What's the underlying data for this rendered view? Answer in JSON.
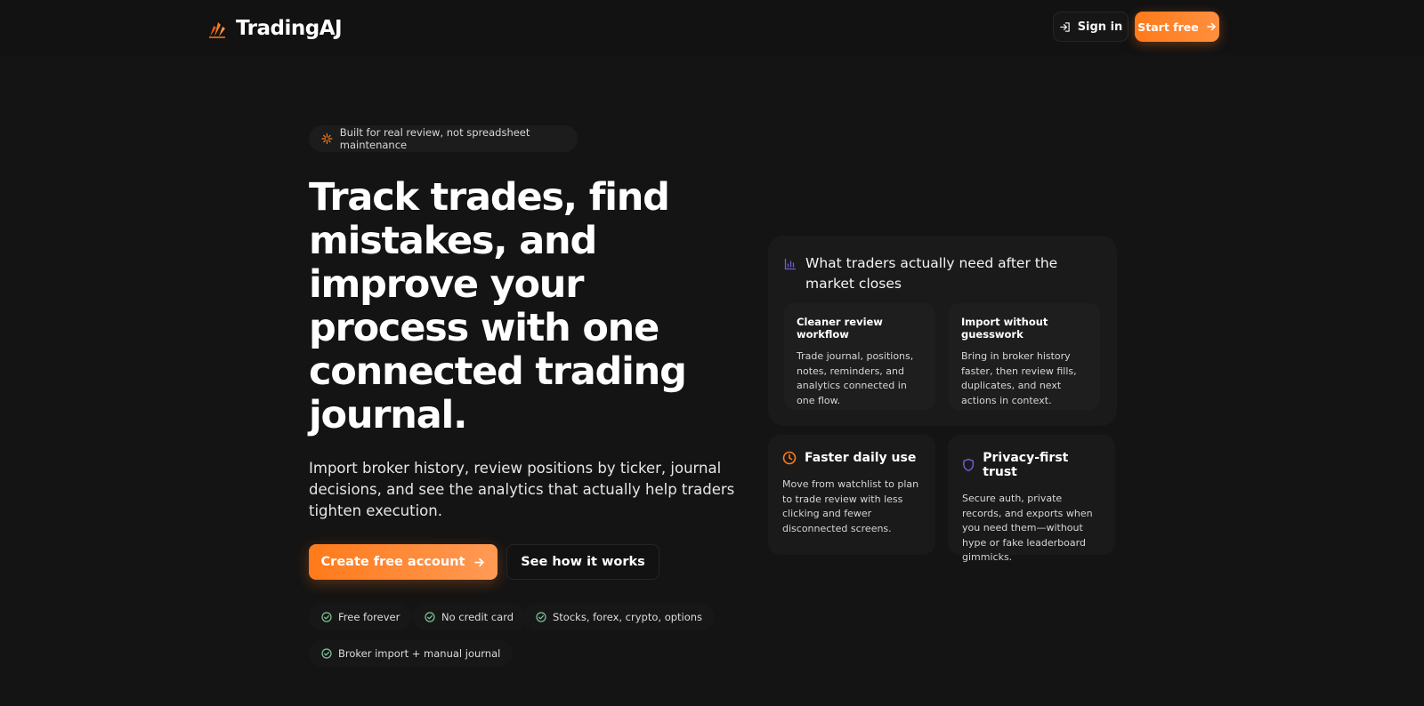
{
  "header": {
    "brand": "TradingAJ",
    "sign_in_label": "Sign in",
    "start_label": "Start free"
  },
  "hero": {
    "pill_text": "Built for real review, not spreadsheet maintenance",
    "headline": "Track trades, find mistakes, and improve your process with one connected trading journal.",
    "subcopy": "Import broker history, review positions by ticker, journal decisions, and see the analytics that actually help traders tighten execution.",
    "primary_cta": "Create free account",
    "secondary_cta": "See how it works",
    "chips": [
      "Free forever",
      "No credit card",
      "Stocks, forex, crypto, options",
      "Broker import + manual journal"
    ]
  },
  "panel": {
    "title": "What traders actually need after the market closes",
    "cards": [
      {
        "title": "Cleaner review workflow",
        "body": "Trade journal, positions, notes, reminders, and analytics connected in one flow."
      },
      {
        "title": "Import without guesswork",
        "body": "Bring in broker history faster, then review fills, duplicates, and next actions in context."
      }
    ]
  },
  "features": [
    {
      "title": "Faster daily use",
      "icon": "clock-icon",
      "body": "Move from watchlist to plan to trade review with less clicking and fewer disconnected screens."
    },
    {
      "title": "Privacy-first trust",
      "icon": "shield-icon",
      "body": "Secure auth, private records, and exports when you need them—without hype or fake leaderboard gimmicks."
    }
  ],
  "colors": {
    "accent": "#ff7a1a",
    "background": "#141414",
    "check": "#7fc79a",
    "chart_icon": "#6d5fd6",
    "shield_icon": "#6d5fd6"
  }
}
